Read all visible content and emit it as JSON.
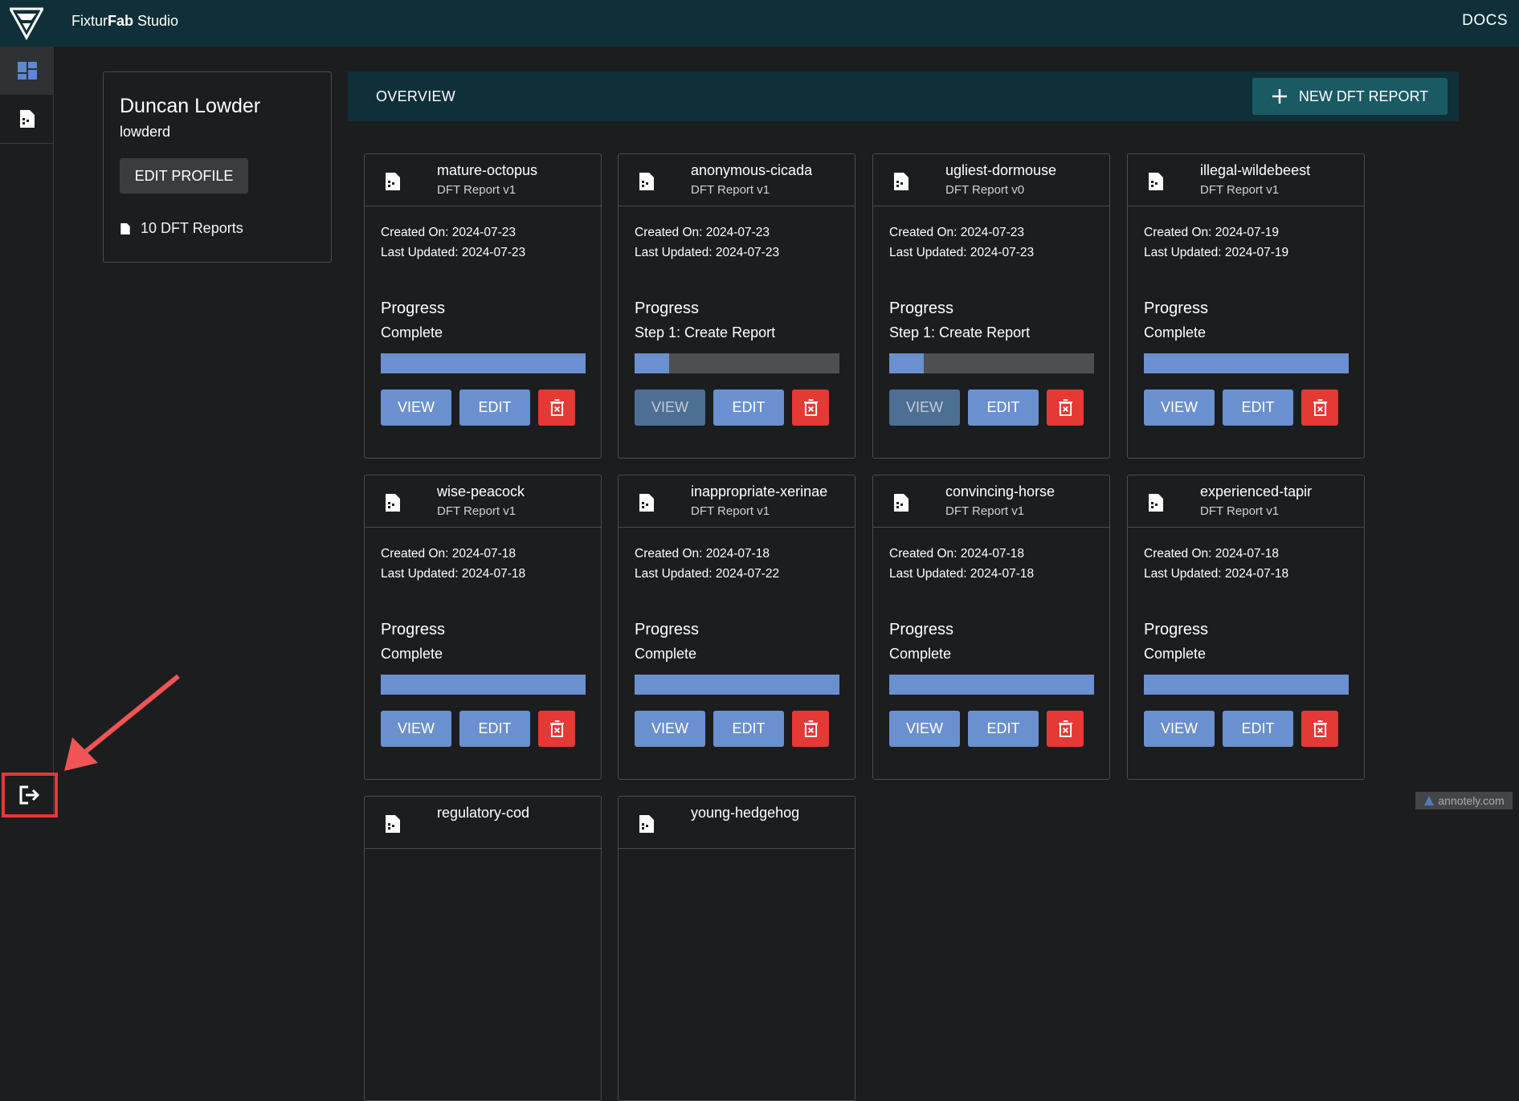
{
  "header": {
    "title_prefix": "Fixtur",
    "title_bold": "Fab",
    "title_suffix": " Studio",
    "docs_label": "DOCS"
  },
  "sidebar": {
    "items": [
      {
        "icon": "dashboard-icon",
        "active": true
      },
      {
        "icon": "report-icon",
        "active": false
      }
    ],
    "logout_icon": "logout-icon"
  },
  "profile": {
    "name": "Duncan Lowder",
    "username": "lowderd",
    "edit_label": "EDIT PROFILE",
    "reports_count": "10 DFT Reports"
  },
  "overview": {
    "title": "OVERVIEW",
    "new_report_label": "NEW DFT REPORT"
  },
  "labels": {
    "created_prefix": "Created On: ",
    "updated_prefix": "Last Updated: ",
    "progress": "Progress",
    "view": "VIEW",
    "edit": "EDIT"
  },
  "colors": {
    "accent": "#6b90cf",
    "header": "#0f3038",
    "danger": "#e53935"
  },
  "reports": [
    {
      "name": "mature-octopus",
      "version": "DFT Report v1",
      "created": "2024-07-23",
      "updated": "2024-07-23",
      "step": "Complete",
      "progress": 1.0
    },
    {
      "name": "anonymous-cicada",
      "version": "DFT Report v1",
      "created": "2024-07-23",
      "updated": "2024-07-23",
      "step": "Step 1: Create Report",
      "progress": 0.17
    },
    {
      "name": "ugliest-dormouse",
      "version": "DFT Report v0",
      "created": "2024-07-23",
      "updated": "2024-07-23",
      "step": "Step 1: Create Report",
      "progress": 0.17
    },
    {
      "name": "illegal-wildebeest",
      "version": "DFT Report v1",
      "created": "2024-07-19",
      "updated": "2024-07-19",
      "step": "Complete",
      "progress": 1.0
    },
    {
      "name": "wise-peacock",
      "version": "DFT Report v1",
      "created": "2024-07-18",
      "updated": "2024-07-18",
      "step": "Complete",
      "progress": 1.0
    },
    {
      "name": "inappropriate-xerinae",
      "version": "DFT Report v1",
      "created": "2024-07-18",
      "updated": "2024-07-22",
      "step": "Complete",
      "progress": 1.0
    },
    {
      "name": "convincing-horse",
      "version": "DFT Report v1",
      "created": "2024-07-18",
      "updated": "2024-07-18",
      "step": "Complete",
      "progress": 1.0
    },
    {
      "name": "experienced-tapir",
      "version": "DFT Report v1",
      "created": "2024-07-18",
      "updated": "2024-07-18",
      "step": "Complete",
      "progress": 1.0
    },
    {
      "name": "regulatory-cod",
      "version": "",
      "created": "",
      "updated": "",
      "step": "",
      "progress": null
    },
    {
      "name": "young-hedgehog",
      "version": "",
      "created": "",
      "updated": "",
      "step": "",
      "progress": null
    }
  ],
  "watermark": "annotely.com"
}
